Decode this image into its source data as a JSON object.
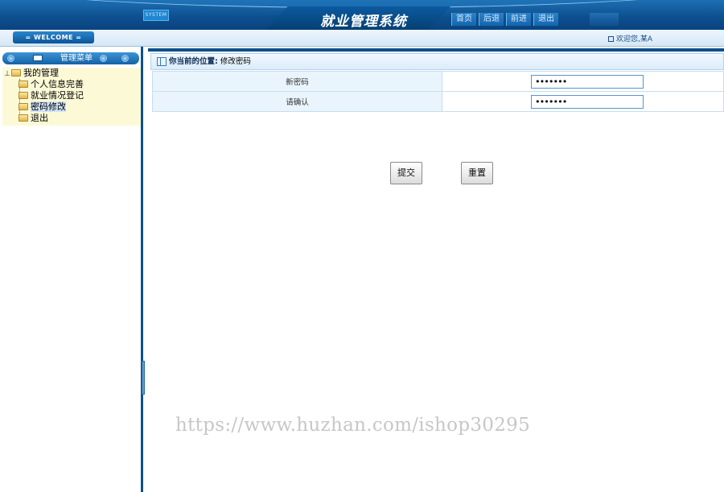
{
  "header": {
    "system_tag": "SYSTEM",
    "app_title": "就业管理系统",
    "nav": [
      "首页",
      "后退",
      "前进",
      "退出"
    ]
  },
  "subbar": {
    "welcome": "= WELCOME =",
    "greeting": "欢迎您,某A"
  },
  "sidebar": {
    "menu_title": "管理菜单",
    "root": "我的管理",
    "items": [
      {
        "label": "个人信息完善"
      },
      {
        "label": "就业情况登记"
      },
      {
        "label": "密码修改",
        "selected": true
      },
      {
        "label": "退出"
      }
    ]
  },
  "breadcrumb": {
    "prefix": "你当前的位置",
    "sep": ":",
    "page": "修改密码"
  },
  "form": {
    "new_password_label": "新密码",
    "new_password_value": "•••••••",
    "confirm_label": "请确认",
    "confirm_value": "•••••••",
    "submit_label": "提交",
    "reset_label": "重置"
  },
  "watermark": "https://www.huzhan.com/ishop30295"
}
